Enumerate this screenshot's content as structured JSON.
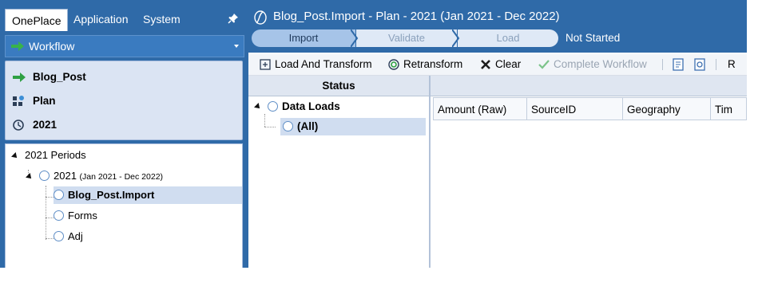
{
  "left": {
    "tabs": [
      {
        "label": "OnePlace",
        "active": true
      },
      {
        "label": "Application",
        "active": false
      },
      {
        "label": "System",
        "active": false
      }
    ],
    "workflow": {
      "label": "Workflow"
    },
    "pov": [
      {
        "icon": "arrow-right-icon",
        "label": "Blog_Post"
      },
      {
        "icon": "scenario-icon",
        "label": "Plan"
      },
      {
        "icon": "clock-icon",
        "label": "2021"
      }
    ],
    "tree": {
      "root": "2021 Periods",
      "period": {
        "label": "2021",
        "sub": "(Jan 2021 - Dec 2022)"
      },
      "children": [
        "Blog_Post.Import",
        "Forms",
        "Adj"
      ]
    }
  },
  "right": {
    "title": "Blog_Post.Import  -  Plan  -  2021 (Jan 2021 - Dec 2022)",
    "steps": [
      {
        "label": "Import",
        "state": "done"
      },
      {
        "label": "Validate",
        "state": "todo"
      },
      {
        "label": "Load",
        "state": "todo"
      }
    ],
    "status": "Not Started",
    "toolbar": {
      "load_transform": "Load And Transform",
      "retransform": "Retransform",
      "clear": "Clear",
      "complete": "Complete Workflow",
      "partial": "R"
    },
    "status_panel": {
      "header": "Status",
      "root": "Data Loads",
      "child": "(All)"
    },
    "grid": {
      "columns": [
        "Amount (Raw)",
        "SourceID",
        "Geography",
        "Tim"
      ]
    }
  },
  "colors": {
    "chrome_blue": "#2f6aa8",
    "progress_done": "#a6c4e8",
    "progress_todo": "#dfe9f6"
  }
}
